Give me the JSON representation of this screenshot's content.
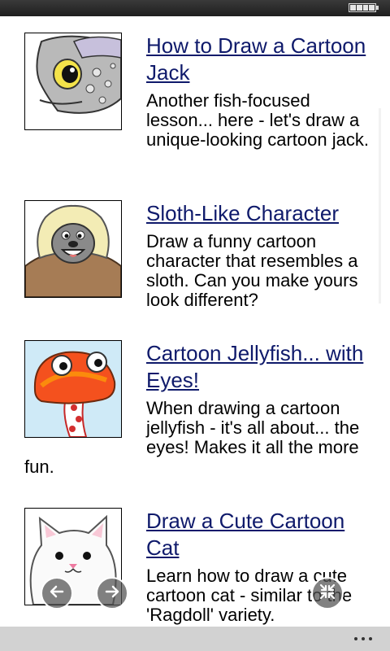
{
  "status_bar": {
    "battery_icon": "battery-full-icon"
  },
  "articles": [
    {
      "title": "How to Draw a Cartoon Jack",
      "description": "Another fish-focused lesson... here - let's draw a unique-looking cartoon jack.",
      "thumbnail": "cartoon-jack-thumbnail"
    },
    {
      "title": "Sloth-Like Character",
      "description": "Draw a funny cartoon character that resembles a sloth. Can you make yours look different?",
      "thumbnail": "sloth-character-thumbnail"
    },
    {
      "title": "Cartoon Jellyfish... with Eyes!",
      "description": "When drawing a cartoon jellyfish - it's all about... the eyes! Makes it all the more fun.",
      "thumbnail": "jellyfish-thumbnail"
    },
    {
      "title": "Draw a Cute Cartoon Cat",
      "description": "Learn how to draw a cute cartoon cat - similar to the 'Ragdoll' variety.",
      "thumbnail": "cartoon-cat-thumbnail"
    }
  ],
  "overlay_controls": {
    "back_icon": "arrow-left-icon",
    "forward_icon": "arrow-right-icon",
    "fullscreen_exit_icon": "collapse-icon"
  },
  "toolbar": {
    "menu_icon": "more-dots-icon"
  }
}
